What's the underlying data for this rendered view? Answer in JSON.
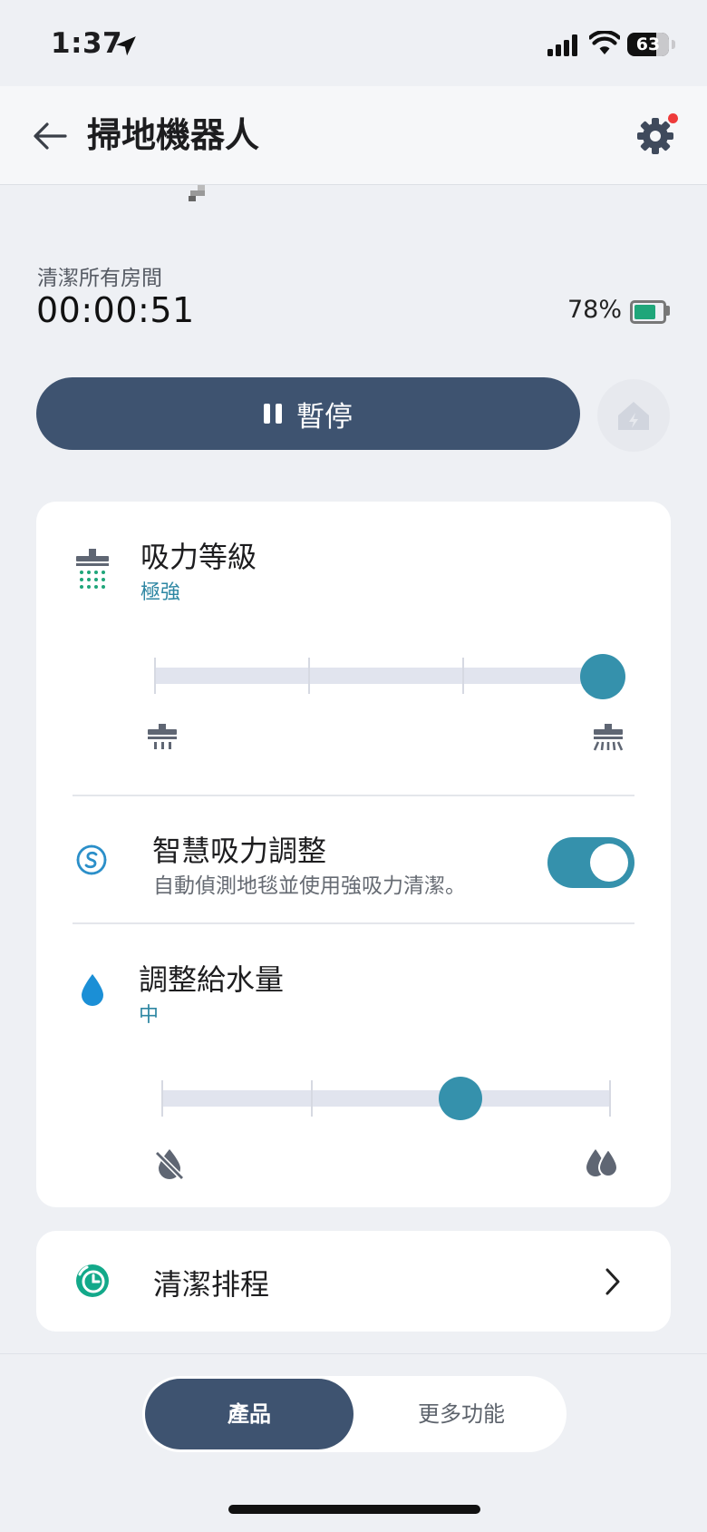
{
  "status_bar": {
    "time": "1:37",
    "battery": "63"
  },
  "header": {
    "title": "掃地機器人"
  },
  "status": {
    "mode": "清潔所有房間",
    "elapsed": "00:00:51",
    "battery": "78%",
    "battery_level": 0.78
  },
  "pause_button": {
    "label": "暫停"
  },
  "suction": {
    "title": "吸力等級",
    "value": "極強",
    "level_index": 3,
    "levels": 4
  },
  "smart_suction": {
    "title": "智慧吸力調整",
    "description": "自動偵測地毯並使用強吸力清潔。",
    "enabled": true
  },
  "water": {
    "title": "調整給水量",
    "value": "中",
    "level_index": 2,
    "levels": 4
  },
  "schedule": {
    "label": "清潔排程"
  },
  "tabs": {
    "active": "產品",
    "inactive": "更多功能"
  },
  "colors": {
    "accent": "#3591ac",
    "primary": "#3e5370",
    "water_icon": "#1b8fd6",
    "schedule_icon": "#13a98a"
  }
}
